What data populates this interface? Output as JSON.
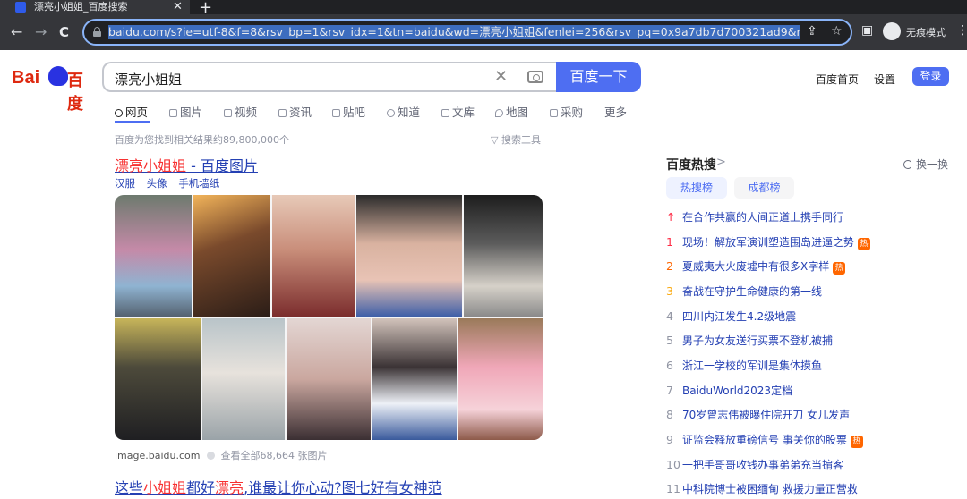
{
  "browser": {
    "tab_title": "漂亮小姐姐_百度搜索",
    "tab_close": "✕",
    "new_tab": "+",
    "url": "baidu.com/s?ie=utf-8&f=8&rsv_bp=1&rsv_idx=1&tn=baidu&wd=漂亮小姐姐&fenlei=256&rsv_pq=0x9a7db7d700321ad9&rsv_t=ac05",
    "back": "←",
    "forward": "→",
    "reload": "C",
    "share_icon": "⇪",
    "star_icon": "☆",
    "incognito_label": "无痕模式",
    "menu_icon": "⋮"
  },
  "header": {
    "logo_bai": "Bai",
    "logo_cn": "百度",
    "query": "漂亮小姐姐",
    "clear": "✕",
    "search_button": "百度一下",
    "home_link": "百度首页",
    "settings_link": "设置",
    "login_button": "登录"
  },
  "verticals": [
    {
      "label": "网页",
      "icon": "search-icon"
    },
    {
      "label": "图片",
      "icon": "image-icon"
    },
    {
      "label": "视频",
      "icon": "video-icon"
    },
    {
      "label": "资讯",
      "icon": "news-icon"
    },
    {
      "label": "贴吧",
      "icon": "tieba-icon"
    },
    {
      "label": "知道",
      "icon": "question-icon"
    },
    {
      "label": "文库",
      "icon": "doc-icon"
    },
    {
      "label": "地图",
      "icon": "map-icon"
    },
    {
      "label": "采购",
      "icon": "cart-icon"
    },
    {
      "label": "更多",
      "icon": ""
    }
  ],
  "results_meta": {
    "count_text": "百度为您找到相关结果约89,800,000个",
    "tools": "▽ 搜索工具"
  },
  "result1": {
    "title_highlight": "漂亮小姐姐",
    "title_rest": " - 百度图片",
    "tags": [
      "汉服",
      "头像",
      "手机墙纸"
    ],
    "source": "image.baidu.com",
    "more": "查看全部68,664 张图片"
  },
  "result2": {
    "part1": "这些",
    "hl1": "小姐姐",
    "part2": "都好",
    "hl2": "漂亮",
    "part3": ",谁最让你心动?图七好有女神范"
  },
  "hot": {
    "title": "百度热搜",
    "chevron": ">",
    "refresh": "换一换",
    "tab_hot": "热搜榜",
    "tab_city": "成都榜",
    "badge": "热",
    "items": [
      {
        "rank": "↑",
        "text": "在合作共赢的人间正道上携手同行"
      },
      {
        "rank": "1",
        "text": "现场！解放军演训塑造围岛进逼之势"
      },
      {
        "rank": "2",
        "text": "夏威夷大火废墟中有很多X字样"
      },
      {
        "rank": "3",
        "text": "奋战在守护生命健康的第一线"
      },
      {
        "rank": "4",
        "text": "四川内江发生4.2级地震"
      },
      {
        "rank": "5",
        "text": "男子为女友送行买票不登机被捕"
      },
      {
        "rank": "6",
        "text": "浙江一学校的军训是集体摸鱼"
      },
      {
        "rank": "7",
        "text": "BaiduWorld2023定档"
      },
      {
        "rank": "8",
        "text": "70岁曾志伟被曝住院开刀 女儿发声"
      },
      {
        "rank": "9",
        "text": "证监会释放重磅信号 事关你的股票"
      },
      {
        "rank": "10",
        "text": "一把手哥哥收钱办事弟弟充当掮客"
      },
      {
        "rank": "11",
        "text": "中科院博士被困缅甸 救援力量正营救"
      }
    ]
  }
}
